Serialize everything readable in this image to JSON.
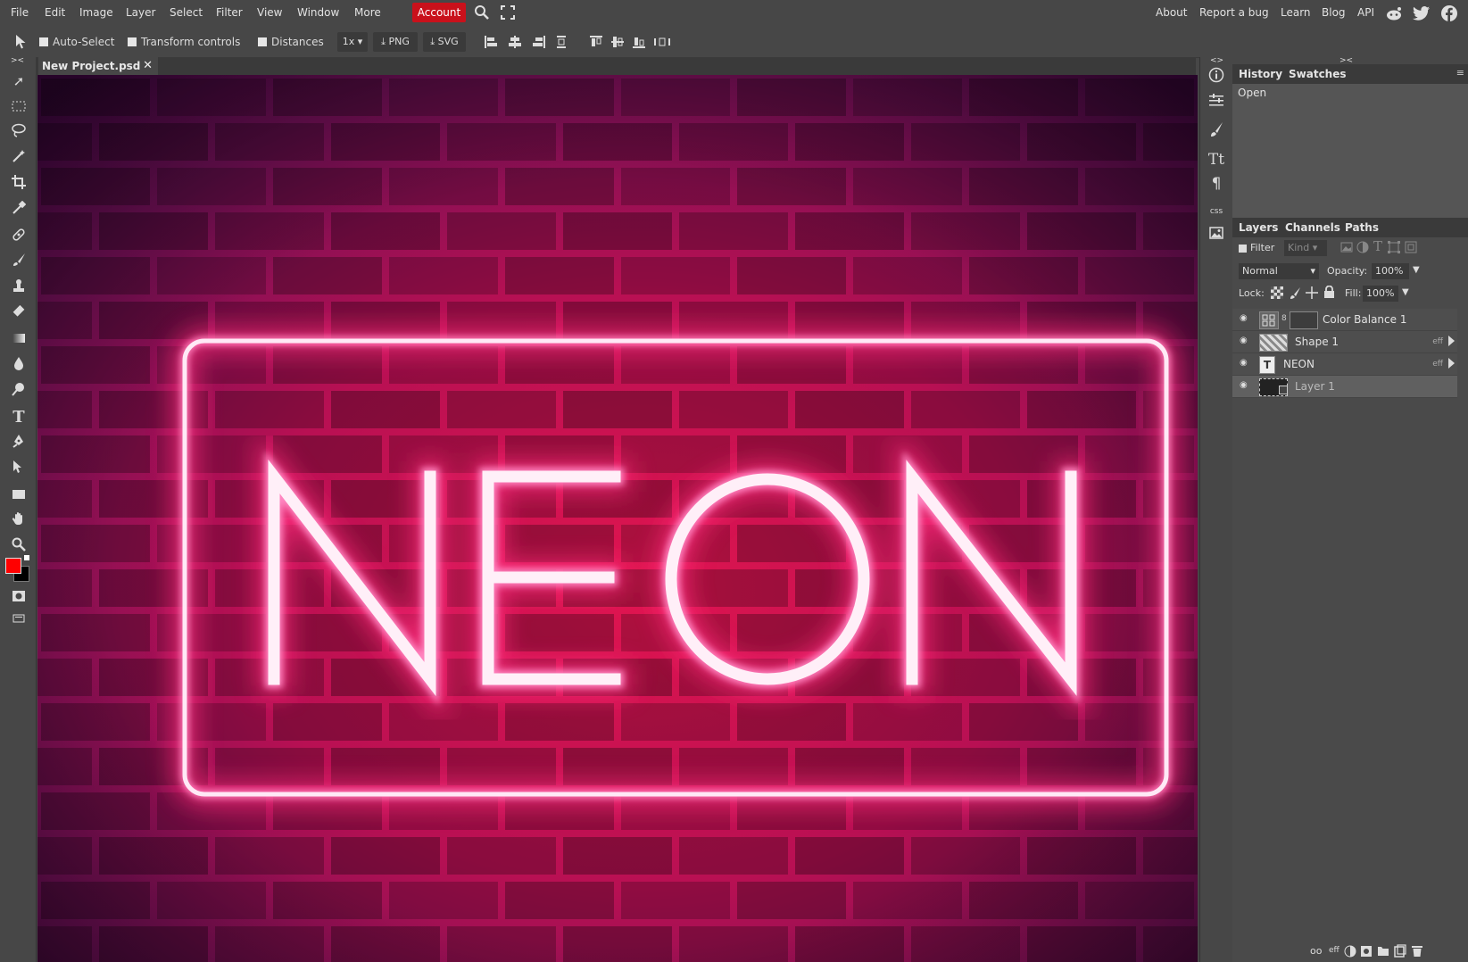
{
  "menu": {
    "items": [
      "File",
      "Edit",
      "Image",
      "Layer",
      "Select",
      "Filter",
      "View",
      "Window",
      "More"
    ],
    "account": "Account",
    "right_links": [
      "About",
      "Report a bug",
      "Learn",
      "Blog",
      "API"
    ]
  },
  "options": {
    "auto_select": "Auto-Select",
    "transform_controls": "Transform controls",
    "distances": "Distances",
    "scale": "1x",
    "png": "PNG",
    "svg": "SVG"
  },
  "document": {
    "tab_title": "New Project.psd",
    "neon_text": "NEON"
  },
  "colors": {
    "accent": "#c9111b",
    "foreground": "#ff0000",
    "background": "#000000",
    "neon_glow": "#ff2a7a",
    "neon_core": "#ffe9f6"
  },
  "history_panel": {
    "tabs": [
      "History",
      "Swatches"
    ],
    "entries": [
      "Open"
    ]
  },
  "layers_panel": {
    "tabs": [
      "Layers",
      "Channels",
      "Paths"
    ],
    "filter_label": "Filter",
    "filter_kind": "Kind",
    "blend_mode": "Normal",
    "opacity_label": "Opacity:",
    "opacity_value": "100%",
    "lock_label": "Lock:",
    "fill_label": "Fill:",
    "fill_value": "100%",
    "layers": [
      {
        "name": "Color Balance 1",
        "fx": ""
      },
      {
        "name": "Shape 1",
        "fx": "eff"
      },
      {
        "name": "NEON",
        "fx": "eff"
      },
      {
        "name": "Layer 1",
        "fx": ""
      }
    ],
    "footer_fx": "eff"
  },
  "right_strip": {
    "css_label": "css"
  }
}
